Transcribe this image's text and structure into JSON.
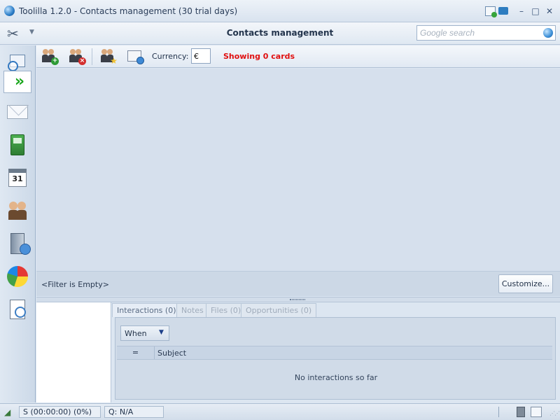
{
  "window": {
    "title": "Toolilla 1.2.0 - Contacts management (30 trial days)",
    "minimize_glyph": "–",
    "maximize_glyph": "□",
    "close_glyph": "✕"
  },
  "header": {
    "tools_icon": "wrench-screwdriver-icon",
    "caret": "▼",
    "title": "Contacts management",
    "search_placeholder": "Google search",
    "search_value": ""
  },
  "sidebar": {
    "items": [
      {
        "name": "search-contacts",
        "icon": "search-card-icon",
        "selected": false
      },
      {
        "name": "forward",
        "icon": "forward-arrows-icon",
        "glyph": "»",
        "selected": true
      },
      {
        "name": "mail",
        "icon": "envelope-icon",
        "selected": false
      },
      {
        "name": "phone",
        "icon": "phone-icon",
        "selected": false
      },
      {
        "name": "calendar",
        "icon": "calendar-icon",
        "glyph": "31",
        "selected": false
      },
      {
        "name": "contacts",
        "icon": "people-icon",
        "selected": false
      },
      {
        "name": "server",
        "icon": "server-icon",
        "selected": false
      },
      {
        "name": "charts",
        "icon": "pie-chart-icon",
        "selected": false
      },
      {
        "name": "reports",
        "icon": "report-icon",
        "selected": false
      }
    ]
  },
  "toolbar": {
    "add_contact_badge": "+",
    "delete_contact_badge": "×",
    "favorite_badge": "★",
    "currency_label": "Currency:",
    "currency_value": "€",
    "showing_text": "Showing 0 cards"
  },
  "filter": {
    "text": "<Filter is Empty>",
    "customize_label": "Customize..."
  },
  "details": {
    "tabs": [
      {
        "label": "Interactions (0)",
        "active": true
      },
      {
        "label": "Notes",
        "active": false
      },
      {
        "label": "Files (0)",
        "active": false
      },
      {
        "label": "Opportunities (0)",
        "active": false
      }
    ],
    "when_label": "When",
    "when_caret": "▼",
    "columns": [
      "=",
      "Subject"
    ],
    "empty_text": "No interactions so far"
  },
  "status": {
    "timer": "S (00:00:00) (0%)",
    "queue": "Q: N/A"
  },
  "colors": {
    "accent_red": "#e01010",
    "background": "#dce6f2",
    "forward_green": "#18a51a"
  }
}
